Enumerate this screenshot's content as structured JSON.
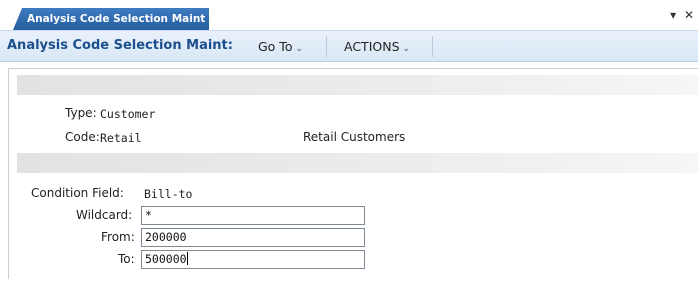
{
  "tab": {
    "label": "Analysis Code Selection Maint"
  },
  "tab_controls": {
    "dropdown": "▾",
    "close": "✕"
  },
  "toolbar": {
    "title": "Analysis Code Selection Maint:",
    "menus": [
      {
        "label": "Go To",
        "caret": "⌄"
      },
      {
        "label": "ACTIONS",
        "caret": "⌄"
      }
    ]
  },
  "header_info": {
    "type": {
      "label": "Type:",
      "value": "Customer"
    },
    "code": {
      "label": "Code:",
      "value": "Retail",
      "description": "Retail Customers"
    }
  },
  "criteria": {
    "condition_field": {
      "label": "Condition Field:",
      "value": "Bill-to"
    },
    "wildcard": {
      "label": "Wildcard:",
      "value": "*"
    },
    "from": {
      "label": "From:",
      "value": "200000"
    },
    "to": {
      "label": "To:",
      "value": "500000"
    }
  }
}
